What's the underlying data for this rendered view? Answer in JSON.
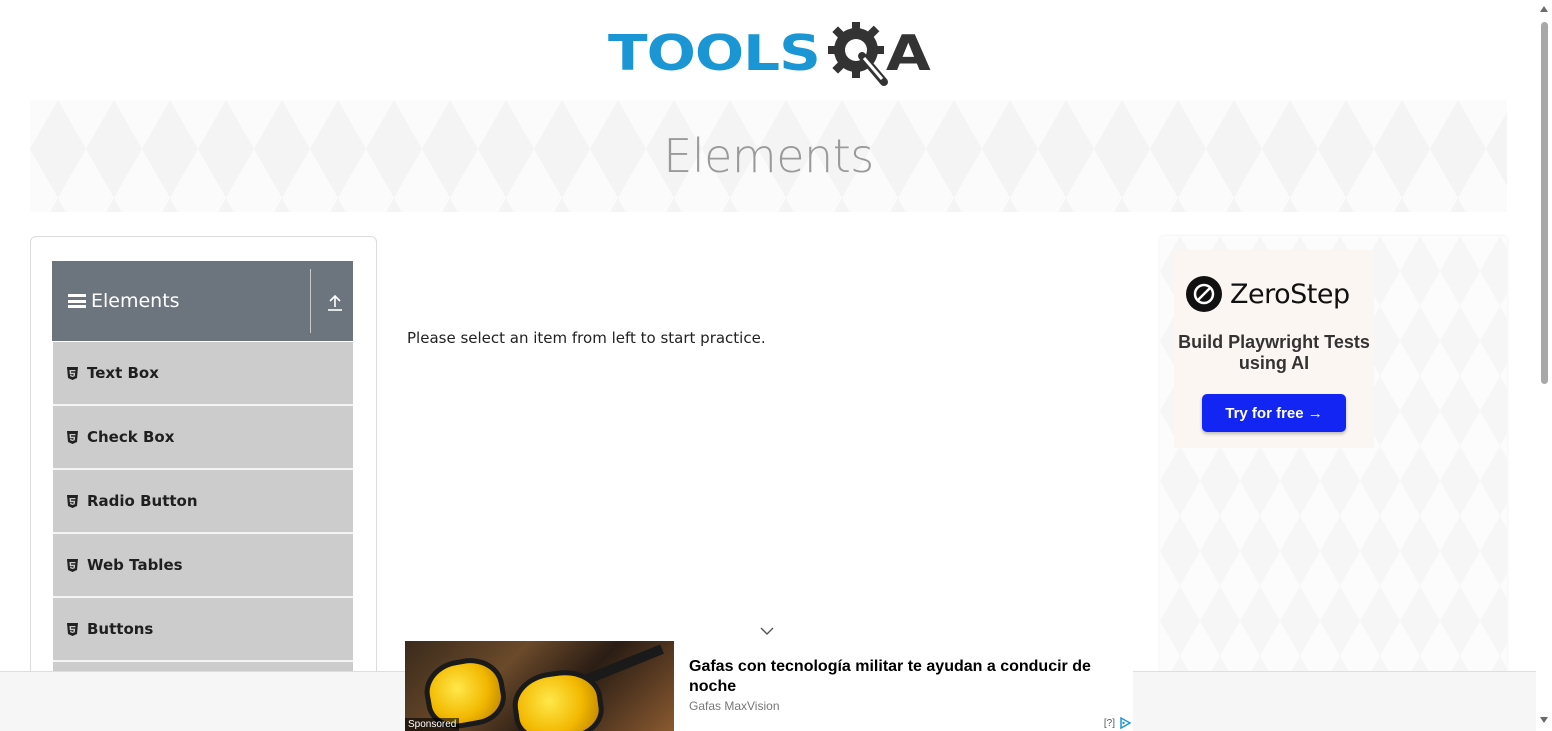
{
  "header": {
    "logo_primary": "TOOLS",
    "logo_secondary": "A",
    "logo_colors": {
      "primary": "#1a96d4",
      "secondary": "#333333"
    }
  },
  "banner": {
    "title": "Elements"
  },
  "sidebar": {
    "group_title": "Elements",
    "group_icon": "hamburger-icon",
    "collapse_icon": "upload-icon",
    "items": [
      {
        "label": "Text Box",
        "icon": "html5-icon"
      },
      {
        "label": "Check Box",
        "icon": "html5-icon"
      },
      {
        "label": "Radio Button",
        "icon": "html5-icon"
      },
      {
        "label": "Web Tables",
        "icon": "html5-icon"
      },
      {
        "label": "Buttons",
        "icon": "html5-icon"
      }
    ],
    "colors": {
      "header_bg": "#6c757d",
      "item_bg": "#cccccc"
    }
  },
  "main": {
    "message": "Please select an item from left to start practice."
  },
  "right_ad": {
    "brand": "ZeroStep",
    "tagline": "Build Playwright Tests using AI",
    "cta": "Try for free →",
    "cta_color": "#1325f2"
  },
  "bottom_ad": {
    "headline": "Gafas con tecnología militar te ayudan a conducir de noche",
    "source": "Gafas MaxVision",
    "sponsored": "Sponsored",
    "info": "[?]"
  }
}
